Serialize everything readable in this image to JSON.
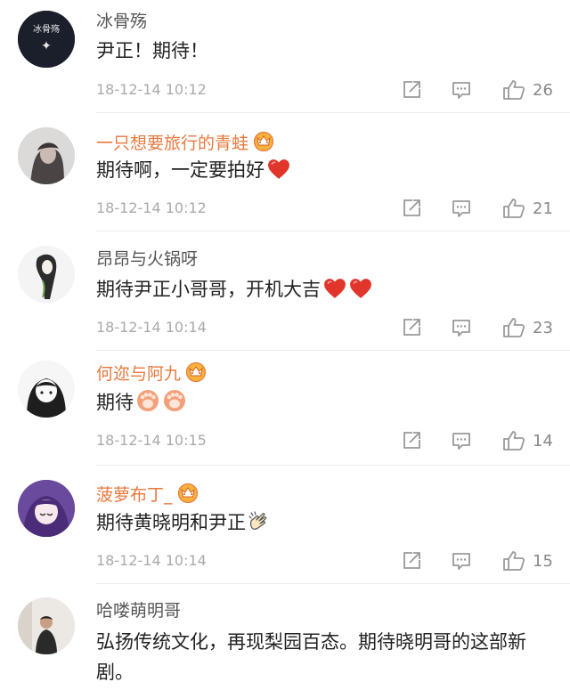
{
  "comments": [
    {
      "username": "冰骨殇",
      "username_style": "plain",
      "vip": false,
      "text": "尹正！期待！",
      "time": "18-12-14 10:12",
      "likes": "26",
      "avatar_text": "冰骨殇"
    },
    {
      "username": "一只想要旅行的青蛙",
      "username_style": "vip",
      "vip": true,
      "text": "期待啊，一定要拍好",
      "time": "18-12-14 10:12",
      "likes": "21",
      "emoji": [
        "heart"
      ]
    },
    {
      "username": "昂昂与火锅呀",
      "username_style": "plain",
      "vip": false,
      "text": "期待尹正小哥哥，开机大吉",
      "time": "18-12-14 10:14",
      "likes": "23",
      "emoji": [
        "heart",
        "heart"
      ]
    },
    {
      "username": "何迩与阿九",
      "username_style": "vip",
      "vip": true,
      "text": "期待",
      "time": "18-12-14 10:15",
      "likes": "14",
      "emoji": [
        "paw",
        "paw"
      ]
    },
    {
      "username": "菠萝布丁_",
      "username_style": "vip",
      "vip": true,
      "text": "期待黄晓明和尹正",
      "time": "18-12-14 10:14",
      "likes": "15",
      "emoji": [
        "hand"
      ]
    },
    {
      "username": "哈喽萌明哥",
      "username_style": "plain",
      "vip": false,
      "text": "弘扬传统文化，再现梨园百态。期待晓明哥的这部新剧。",
      "time": "",
      "likes": ""
    }
  ],
  "colors": {
    "vip_name": "#e8793e",
    "plain_name": "#555555",
    "heart": "#e0352b",
    "icon": "#999999",
    "time": "#aaaaaa"
  },
  "icons": {
    "share": "edit-share-icon",
    "reply": "comment-icon",
    "like": "thumbs-up-icon",
    "vip": "vip-crown-icon"
  }
}
